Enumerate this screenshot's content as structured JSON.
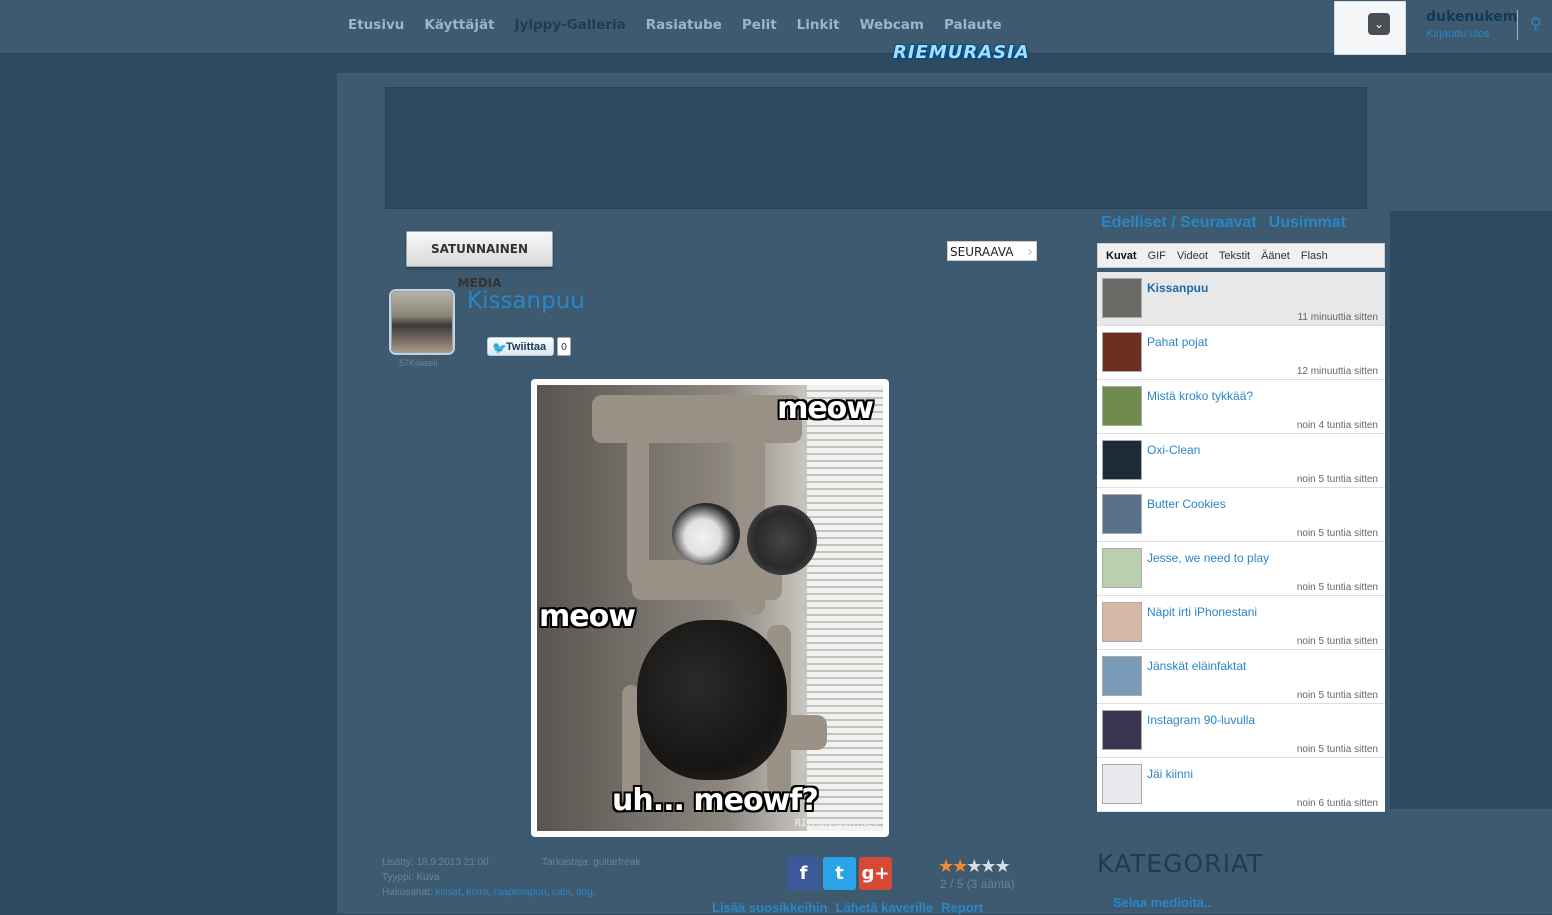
{
  "nav": {
    "items": [
      "Etusivu",
      "Käyttäjät",
      "Jylppy-Galleria",
      "Rasiatube",
      "Pelit",
      "Linkit",
      "Webcam",
      "Palaute"
    ],
    "active": "Jylppy-Galleria"
  },
  "logo": "RIEMURASIA",
  "user": {
    "name": "dukenukem",
    "logout": "Kirjaudu ulos"
  },
  "buttons": {
    "random": "SATUNNAINEN MEDIA",
    "next": "SEURAAVA"
  },
  "media": {
    "title": "Kissanpuu",
    "uploader": "57Kilaseli",
    "tweet_label": "Twiittaa",
    "tweet_count": "0",
    "meme_top": "meow",
    "meme_middle": "meow",
    "meme_bottom": "uh... meowf?",
    "watermark": "RIEMURASIA.NET"
  },
  "meta": {
    "added": "Lisätty: 18.9.2013 21:00",
    "reviewer": "Tarkastaja: guitarfreak",
    "type": "Tyyppi: Kuva",
    "tags_label": "Hakusanat:",
    "tags": [
      "kissat",
      "koira",
      "raapimapuu",
      "cats",
      "dog"
    ]
  },
  "rating": {
    "value": 2,
    "max": 5,
    "text": "2 / 5 (3 ääntä)"
  },
  "social": {
    "facebook": "f",
    "twitter": "t",
    "gplus": "g+"
  },
  "bottom_links": [
    "Lisää suosikkeihin",
    "Lähetä kaverille",
    "Report"
  ],
  "sidebar": {
    "prevnext": "Edelliset / Seuraavat",
    "newest": "Uusimmat",
    "tabs": [
      "Kuvat",
      "GIF",
      "Videot",
      "Tekstit",
      "Äänet",
      "Flash"
    ],
    "active_tab": "Kuvat",
    "items": [
      {
        "title": "Kissanpuu",
        "time": "11 minuuttia sitten",
        "thumb_color": "#6c6a66"
      },
      {
        "title": "Pahat pojat",
        "time": "12 minuuttia sitten",
        "thumb_color": "#6a2f1f"
      },
      {
        "title": "Mistä kroko tykkää?",
        "time": "noin 4 tuntia sitten",
        "thumb_color": "#6f8c4c"
      },
      {
        "title": "Oxi-Clean",
        "time": "noin 5 tuntia sitten",
        "thumb_color": "#1f2a38"
      },
      {
        "title": "Butter Cookies",
        "time": "noin 5 tuntia sitten",
        "thumb_color": "#5a6f8a"
      },
      {
        "title": "Jesse, we need to play",
        "time": "noin 5 tuntia sitten",
        "thumb_color": "#b9d0b0"
      },
      {
        "title": "Näpit irti iPhonestani",
        "time": "noin 5 tuntia sitten",
        "thumb_color": "#d7b8a6"
      },
      {
        "title": "Jänskät eläinfaktat",
        "time": "noin 5 tuntia sitten",
        "thumb_color": "#7a9bb8"
      },
      {
        "title": "Instagram 90-luvulla",
        "time": "noin 5 tuntia sitten",
        "thumb_color": "#3a3550"
      },
      {
        "title": "Jäi kiinni",
        "time": "noin 6 tuntia sitten",
        "thumb_color": "#e8eaee"
      }
    ]
  },
  "categories": {
    "title": "KATEGORIAT",
    "browse": "Selaa medioita.."
  }
}
